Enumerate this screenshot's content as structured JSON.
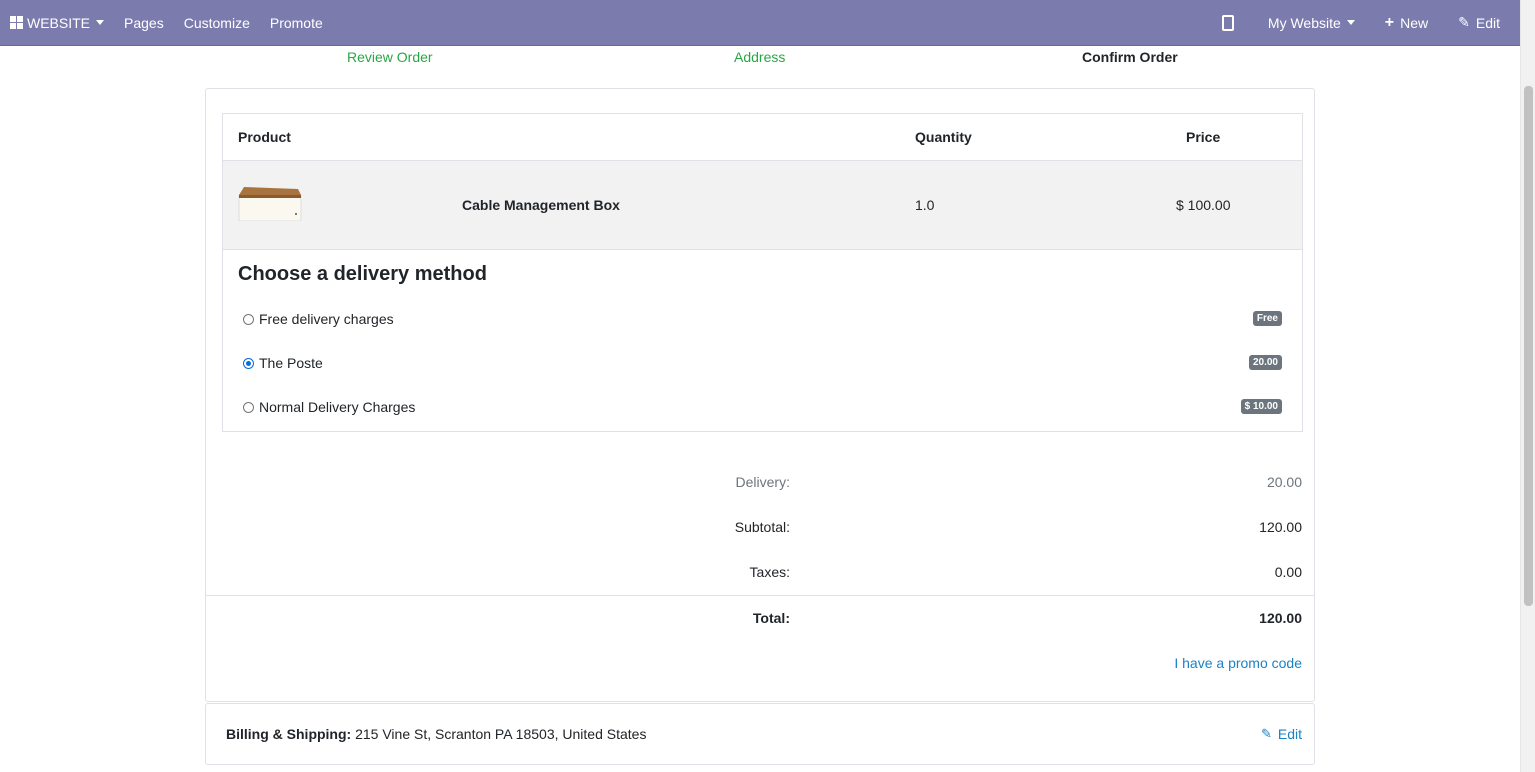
{
  "topbar": {
    "brand": "WEBSITE",
    "menu": [
      "Pages",
      "Customize",
      "Promote"
    ],
    "site_selector": "My Website",
    "new_label": "New",
    "edit_label": "Edit",
    "bg_color": "#7c7bad"
  },
  "steps": [
    "Review Order",
    "Address",
    "Confirm Order"
  ],
  "table": {
    "headers": {
      "product": "Product",
      "quantity": "Quantity",
      "price": "Price"
    },
    "row": {
      "name": "Cable Management Box",
      "quantity": "1.0",
      "price": "$ 100.00"
    }
  },
  "delivery": {
    "title": "Choose a delivery method",
    "options": [
      {
        "label": "Free delivery charges",
        "badge": "Free",
        "selected": false
      },
      {
        "label": "The Poste",
        "badge": "20.00",
        "selected": true
      },
      {
        "label": "Normal Delivery Charges",
        "badge": "$ 10.00",
        "selected": false
      }
    ]
  },
  "summary": {
    "delivery_label": "Delivery:",
    "delivery_value": "20.00",
    "subtotal_label": "Subtotal:",
    "subtotal_value": "120.00",
    "taxes_label": "Taxes:",
    "taxes_value": "0.00",
    "total_label": "Total:",
    "total_value": "120.00",
    "promo_link": "I have a promo code"
  },
  "billing": {
    "label": "Billing & Shipping:",
    "address": " 215 Vine St, Scranton PA 18503, United States",
    "edit_label": "Edit"
  },
  "colors": {
    "step_done": "#28a745",
    "link": "#1a83c4",
    "badge": "#6c757d"
  }
}
